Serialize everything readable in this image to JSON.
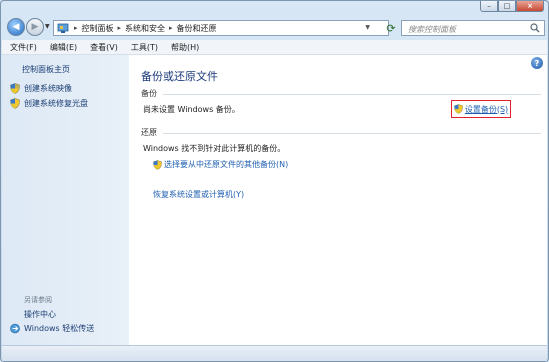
{
  "window": {
    "caption": {
      "min": "–",
      "max": "□",
      "close": "×"
    }
  },
  "nav": {
    "back": "◀",
    "forward": "▶",
    "breadcrumb": [
      "控制面板",
      "系统和安全",
      "备份和还原"
    ],
    "search_placeholder": "搜索控制面板"
  },
  "menu": [
    "文件(F)",
    "编辑(E)",
    "查看(V)",
    "工具(T)",
    "帮助(H)"
  ],
  "sidebar": {
    "home": "控制面板主页",
    "links": [
      "创建系统映像",
      "创建系统修复光盘"
    ],
    "see_also": "另请参阅",
    "see_also_links": [
      "操作中心",
      "Windows 轻松传送"
    ]
  },
  "main": {
    "help": "?",
    "title": "备份或还原文件",
    "backup": {
      "label": "备份",
      "status": "尚未设置 Windows 备份。",
      "setup_link": "设置备份(S)"
    },
    "restore": {
      "label": "还原",
      "status": "Windows 找不到针对此计算机的备份。",
      "choose_link": "选择要从中还原文件的其他备份(N)",
      "recover_link": "恢复系统设置或计算机(Y)"
    }
  },
  "colors": {
    "link": "#1f5fb0",
    "title": "#1c3b7a",
    "highlight_box": "#e0202a"
  }
}
